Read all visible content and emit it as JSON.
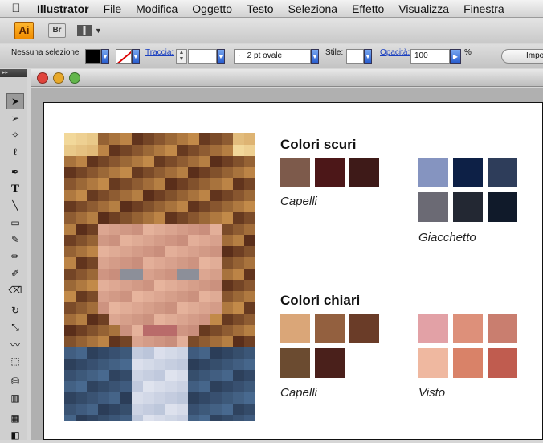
{
  "menubar": {
    "app": "Illustrator",
    "items": [
      "File",
      "Modifica",
      "Oggetto",
      "Testo",
      "Seleziona",
      "Effetto",
      "Visualizza",
      "Finestra"
    ]
  },
  "appbar": {
    "logo": "Ai",
    "bridge": "Br"
  },
  "control": {
    "selection": "Nessuna selezione",
    "stroke_label": "Traccia:",
    "brush_value": "2 pt ovale",
    "style_label": "Stile:",
    "opacity_label": "Opacità:",
    "opacity_value": "100",
    "percent": "%",
    "import_label": "Impo"
  },
  "palette": {
    "dark_title": "Colori scuri",
    "light_title": "Colori chiari",
    "captions": {
      "dark_hair": "Capelli",
      "jacket": "Giacchetto",
      "light_hair": "Capelli",
      "face": "Visto"
    },
    "dark_hair": [
      "#7d5a4b",
      "#4c1718",
      "#3e1a18"
    ],
    "jacket": [
      "#8594c0",
      "#0d2046",
      "#2e3d5a",
      "#6b6a74",
      "#232833",
      "#101a2a"
    ],
    "light_hair": [
      "#daa678",
      "#93603f",
      "#6a3c28",
      "#6b4b30",
      "#4a201b"
    ],
    "face": [
      "#e2a1a6",
      "#dd907a",
      "#c97e6f",
      "#efb8a0",
      "#d98268",
      "#c05c4f"
    ]
  },
  "colors": {
    "accent": "#f08c00",
    "link": "#1a3fbf"
  }
}
